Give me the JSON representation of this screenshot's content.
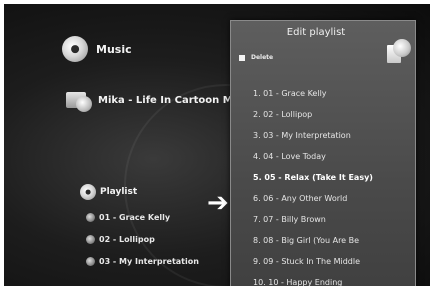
{
  "nav": {
    "music_label": "Music",
    "album_label": "Mika - Life In Cartoon Moti",
    "playlist_label": "Playlist",
    "playlist_items": [
      "01 - Grace Kelly",
      "02 - Lollipop",
      "03 - My Interpretation"
    ]
  },
  "edit_playlist": {
    "title": "Edit playlist",
    "delete_label": "Delete",
    "selected_index": 4,
    "tracks": [
      "1. 01 - Grace Kelly",
      "2. 02 - Lollipop",
      "3. 03 - My Interpretation",
      "4. 04 - Love Today",
      "5. 05 - Relax (Take It Easy)",
      "6. 06 - Any Other World",
      "7. 07 - Billy Brown",
      "8. 08 - Big Girl (You Are Be",
      "9. 09 - Stuck In The Middle",
      "10. 10 - Happy Ending"
    ]
  },
  "icons": {
    "music": "music-disc-icon",
    "album": "album-folder-icon",
    "playlist": "playlist-icon",
    "arrow": "right-arrow-icon"
  }
}
